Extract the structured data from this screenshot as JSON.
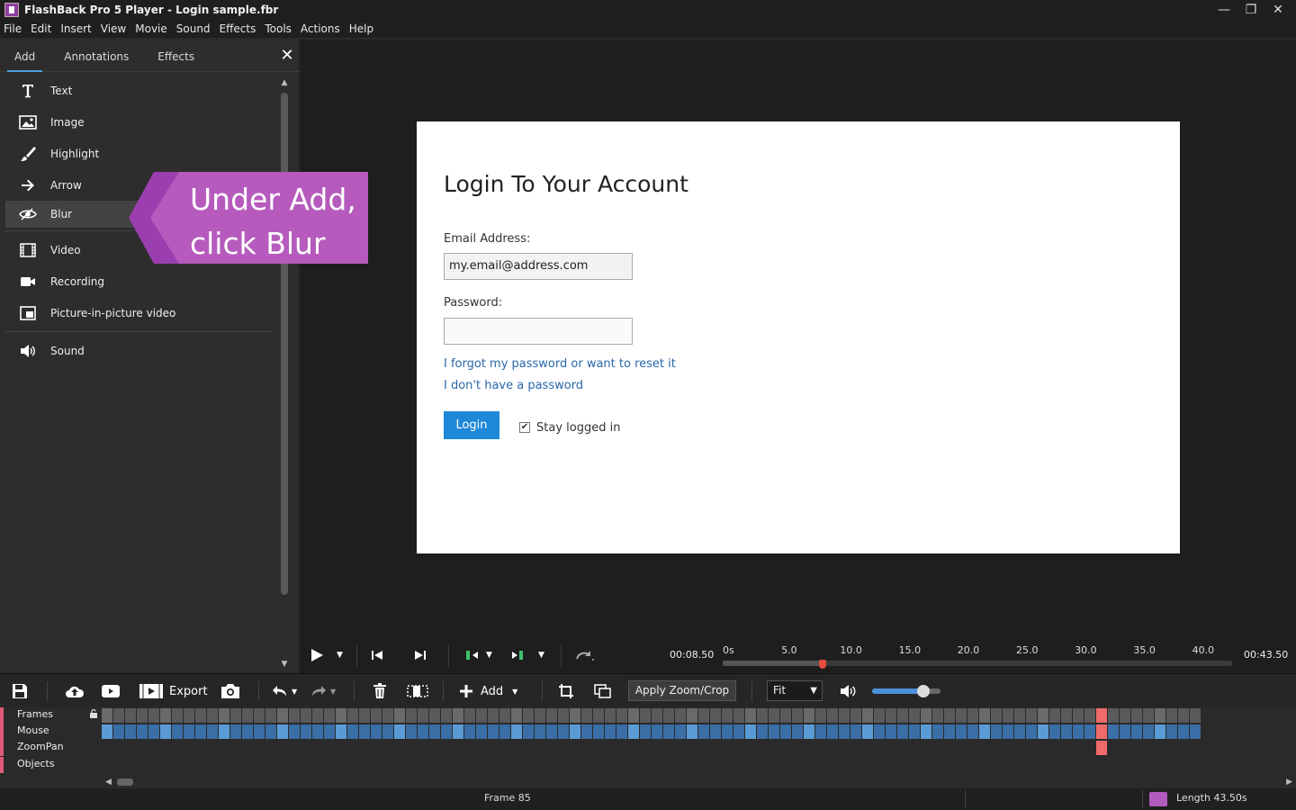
{
  "window": {
    "title": "FlashBack Pro 5 Player - Login sample.fbr",
    "minimize": "—",
    "restore": "❐",
    "close": "✕"
  },
  "menu": [
    "File",
    "Edit",
    "Insert",
    "View",
    "Movie",
    "Sound",
    "Effects",
    "Tools",
    "Actions",
    "Help"
  ],
  "left_panel": {
    "tabs": [
      "Add",
      "Annotations",
      "Effects"
    ],
    "active_tab": "Add",
    "close": "✕",
    "items": [
      {
        "label": "Text",
        "icon": "text-icon"
      },
      {
        "label": "Image",
        "icon": "image-icon"
      },
      {
        "label": "Highlight",
        "icon": "highlight-brush-icon"
      },
      {
        "label": "Arrow",
        "icon": "arrow-right-icon"
      },
      {
        "label": "Blur",
        "icon": "blur-eye-icon",
        "selected": true
      },
      {
        "label": "Video",
        "icon": "film-icon"
      },
      {
        "label": "Recording",
        "icon": "camera-icon"
      },
      {
        "label": "Picture-in-picture video",
        "icon": "pip-icon"
      },
      {
        "label": "Sound",
        "icon": "speaker-icon"
      }
    ]
  },
  "callout": {
    "line1": "Under Add,",
    "line2": "click Blur",
    "color": "#b65bbd"
  },
  "login_page": {
    "title": "Login To Your Account",
    "email_label": "Email Address:",
    "email_value": "my.email@address.com",
    "password_label": "Password:",
    "password_value": "",
    "forgot_link": "I forgot my password or want to reset it",
    "no_password_link": "I don't have a password",
    "login_button": "Login",
    "stay_logged_in": "Stay logged in",
    "stay_logged_in_checked": true
  },
  "playback": {
    "current_time": "00:08.50",
    "total_time": "00:43.50",
    "ruler_ticks": [
      "0s",
      "5.0",
      "10.0",
      "15.0",
      "20.0",
      "25.0",
      "30.0",
      "35.0",
      "40.0"
    ],
    "position_seconds": 8.5,
    "length_seconds": 43.5
  },
  "toolbar": {
    "export_label": "Export",
    "add_label": "Add",
    "apply_zoom_crop": "Apply Zoom/Crop",
    "fit_value": "Fit",
    "volume_level": 0.75
  },
  "timeline": {
    "tracks": [
      "Frames",
      "Mouse",
      "ZoomPan",
      "Objects"
    ]
  },
  "status": {
    "frame": "Frame 85",
    "length": "Length 43.50s"
  },
  "colors": {
    "accent": "#4aa3df",
    "login_button": "#1e88d8",
    "link": "#2a67a8",
    "marker": "#e74c3c",
    "callout": "#b65bbd"
  }
}
